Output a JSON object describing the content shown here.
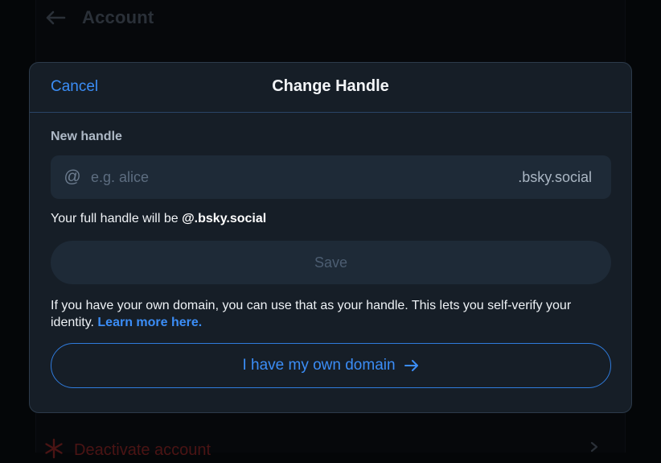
{
  "background": {
    "page_title": "Account",
    "danger_item_label": "Deactivate account"
  },
  "modal": {
    "cancel_label": "Cancel",
    "title": "Change Handle",
    "field_label": "New handle",
    "input": {
      "value": "",
      "placeholder": "e.g. alice",
      "prefix": "@",
      "suffix": ".bsky.social"
    },
    "full_handle_prefix": "Your full handle will be ",
    "full_handle_value": "@.bsky.social",
    "save_label": "Save",
    "domain_info": "If you have your own domain, you can use that as your handle. This lets you self-verify your identity. ",
    "learn_more_label": "Learn more here.",
    "own_domain_label": "I have my own domain"
  },
  "colors": {
    "accent": "#3b8df6",
    "modal_bg": "#161e27",
    "input_bg": "#1e2a37",
    "danger": "#4a1414"
  },
  "icons": {
    "back": "arrow-left-icon",
    "at": "at-sign-icon",
    "arrow_right": "arrow-right-icon",
    "danger": "snowflake-icon",
    "chevron": "chevron-right-icon"
  }
}
